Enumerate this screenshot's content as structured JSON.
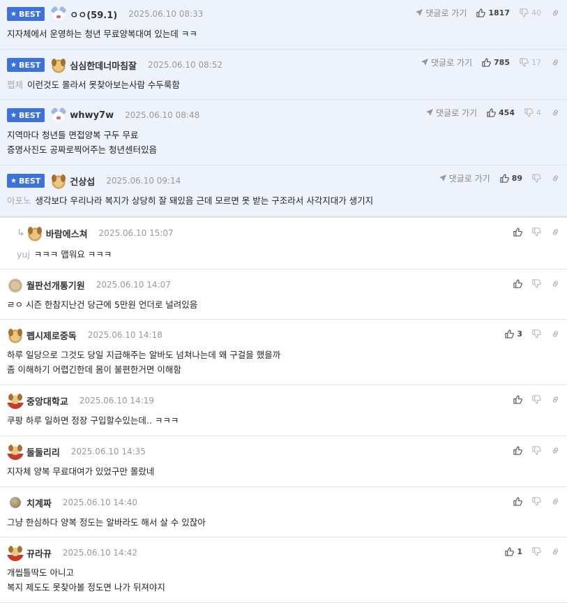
{
  "comments": [
    {
      "best": true,
      "badge": "BEST",
      "avatar": "bear",
      "nick": "ㅇㅇ(59.1)",
      "date": "2025.06.10 08:33",
      "goto": "댓글로 가기",
      "likes": "1817",
      "dislikes": "40",
      "prefix": "",
      "text": "지자체에서 운영하는 청년 무료양복대여 있는데 ㅋㅋ"
    },
    {
      "best": true,
      "badge": "BEST",
      "avatar": "dog",
      "nick": "심심한데너마침잘",
      "date": "2025.06.10 08:52",
      "goto": "댓글로 가기",
      "likes": "785",
      "dislikes": "17",
      "prefix": "펩제",
      "text": "이런것도 몰라서 못찾아보는사람 수두룩함"
    },
    {
      "best": true,
      "badge": "BEST",
      "avatar": "bear",
      "nick": "whwy7w",
      "date": "2025.06.10 08:48",
      "goto": "댓글로 가기",
      "likes": "454",
      "dislikes": "4",
      "prefix": "",
      "text": "지역마다 청년들 면접양복 구두 무료\n증명사진도 공짜로찍어주는 청년센터있음"
    },
    {
      "best": true,
      "badge": "BEST",
      "avatar": "dog",
      "nick": "건상섭",
      "date": "2025.06.10 09:14",
      "goto": "댓글로 가기",
      "likes": "89",
      "dislikes": "",
      "prefix": "아포노",
      "text": "생각보다 우리나라 복지가 상당히 잘 돼있음 근데 모르면 못 받는 구조라서 사각지대가 생기지"
    },
    {
      "reply": true,
      "avatar": "dog",
      "nick": "바람에스쳐",
      "date": "2025.06.10 15:07",
      "likes": "",
      "dislikes": "",
      "prefix": "yuj",
      "text": "ㅋㅋㅋ 맵워요 ㅋㅋㅋ"
    },
    {
      "avatar": "blur",
      "nick": "월판선개통기원",
      "date": "2025.06.10 14:07",
      "likes": "",
      "dislikes": "",
      "prefix": "",
      "text": "ㄹㅇ 시즌 한참지난건 당근에 5만원 언더로 널려있음"
    },
    {
      "avatar": "dog",
      "nick": "펩시제로중독",
      "date": "2025.06.10 14:18",
      "likes": "3",
      "dislikes": "",
      "prefix": "",
      "text": "하루 일당으로 그것도 당일 지급해주는 알바도 넘쳐나는데 왜 구걸을 했을까\n좀 이해하기 어렵긴한데 몸이 불편한거면 이해함"
    },
    {
      "avatar": "dog-red",
      "nick": "중앙대학교",
      "date": "2025.06.10 14:19",
      "likes": "",
      "dislikes": "",
      "prefix": "",
      "text": "쿠팡 하루 일하면 정장 구입할수있는데.. ㅋㅋㅋ"
    },
    {
      "avatar": "dog-red",
      "nick": "둘둘리리",
      "date": "2025.06.10 14:35",
      "likes": "",
      "dislikes": "",
      "prefix": "",
      "text": "지자체 양복 무료대여가 있었구만 몰랐네"
    },
    {
      "avatar": "ball",
      "nick": "치계짜",
      "date": "2025.06.10 14:40",
      "likes": "",
      "dislikes": "",
      "prefix": "",
      "text": "그냥 한심하다 양복 정도는 알바라도 해서 살 수 있잖아"
    },
    {
      "avatar": "dog-red",
      "nick": "뀨라뀨",
      "date": "2025.06.10 14:42",
      "likes": "1",
      "dislikes": "",
      "prefix": "",
      "text": "개씹틀딱도 아니고\n복지 제도도 못찾아볼 정도면 나가 뒤져야지"
    }
  ]
}
